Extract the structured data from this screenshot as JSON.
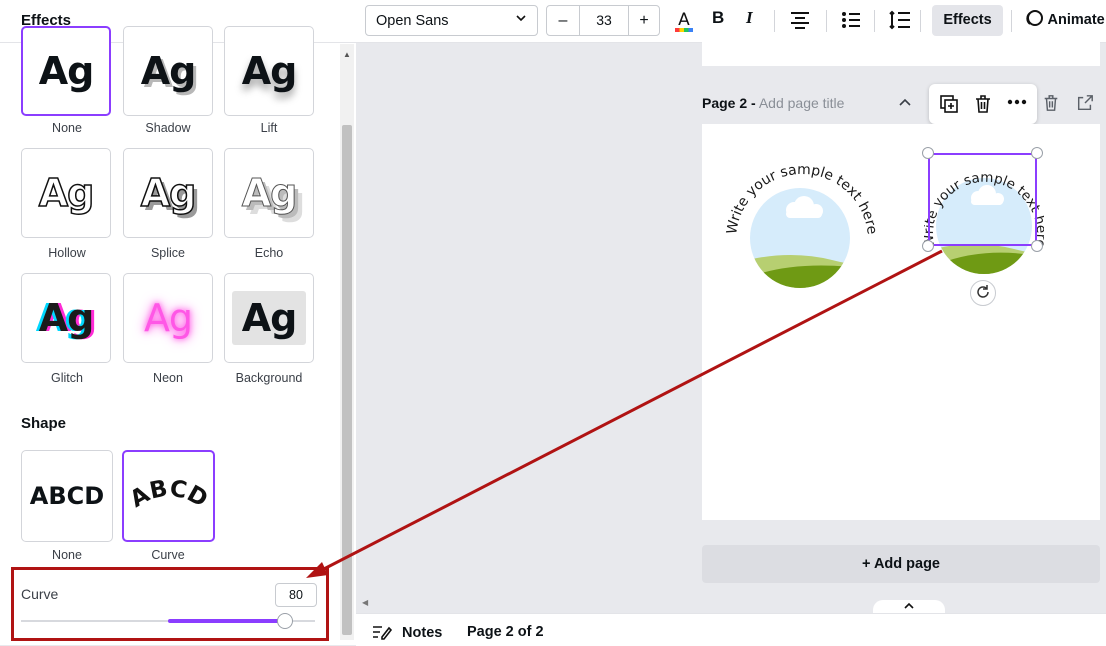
{
  "panel": {
    "title": "Effects",
    "style_items": [
      {
        "label": "None",
        "selected": true
      },
      {
        "label": "Shadow",
        "selected": false
      },
      {
        "label": "Lift",
        "selected": false
      },
      {
        "label": "Hollow",
        "selected": false
      },
      {
        "label": "Splice",
        "selected": false
      },
      {
        "label": "Echo",
        "selected": false
      },
      {
        "label": "Glitch",
        "selected": false
      },
      {
        "label": "Neon",
        "selected": false
      },
      {
        "label": "Background",
        "selected": false
      }
    ],
    "style_preview_text": "Ag",
    "shape_heading": "Shape",
    "shape_items": [
      {
        "label": "None",
        "preview": "ABCD",
        "selected": false
      },
      {
        "label": "Curve",
        "preview": "ABCD",
        "selected": true
      }
    ],
    "curve": {
      "label": "Curve",
      "value": "80",
      "slider_fraction": 0.9
    }
  },
  "toolbar": {
    "font": "Open Sans",
    "size": "33",
    "minus": "–",
    "plus": "+",
    "bold": "B",
    "italic": "I",
    "effects": "Effects",
    "animate": "Animate"
  },
  "canvas": {
    "page_label": "Page 2 -",
    "page_title_placeholder": "Add page title",
    "curved_text": "Write your sample text here",
    "add_page": "+ Add page"
  },
  "bottom": {
    "notes": "Notes",
    "page_count": "Page 2 of 2"
  },
  "colors": {
    "accent": "#8b3dff",
    "highlight": "#b01313"
  }
}
